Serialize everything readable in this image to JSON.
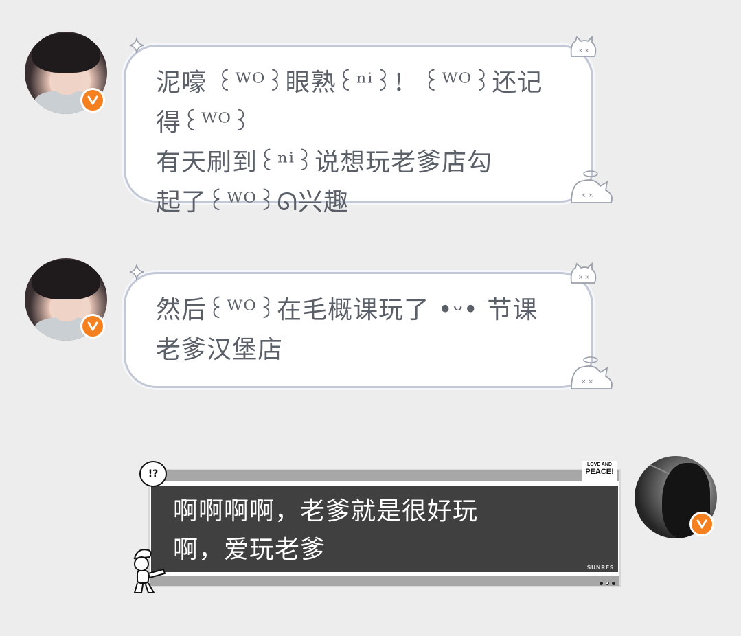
{
  "messages": [
    {
      "sender": "other",
      "verified_badge": "V",
      "text_line1": "泥嚎 ꒰ᵂᴼ꒱眼熟꒰ⁿⁱ꒱！ ꒰ᵂᴼ꒱还记得꒰ᵂᴼ꒱",
      "text_line2": "有天刷到꒰ⁿⁱ꒱说想玩老爹店勾",
      "text_line3": "起了꒰ᵂᴼ꒱ᘏ兴趣"
    },
    {
      "sender": "other",
      "verified_badge": "V",
      "text_line1": "然后꒰ᵂᴼ꒱在毛概课玩了 •ᵕ• 节课",
      "text_line2": "老爹汉堡店"
    },
    {
      "sender": "self",
      "verified_badge": "V",
      "text_line1": "啊啊啊啊，老爹就是很好玩",
      "text_line2": "啊，爱玩老爹",
      "sticker_top_line1": "LOVE AND",
      "sticker_top_line2": "PEACE!",
      "brand_label": "SUNRFS",
      "speech_icon": "!?"
    }
  ],
  "colors": {
    "background": "#ededed",
    "bubble_border": "#c2c8d6",
    "bubble_text": "#5a5f68",
    "dark_card": "#404040",
    "badge": "#f5801f"
  },
  "icons": [
    "verified-badge-icon",
    "sparkle-icon",
    "cat-face-icon",
    "speech-exclaim-icon",
    "love-peace-sticker",
    "smurf-sticker"
  ]
}
